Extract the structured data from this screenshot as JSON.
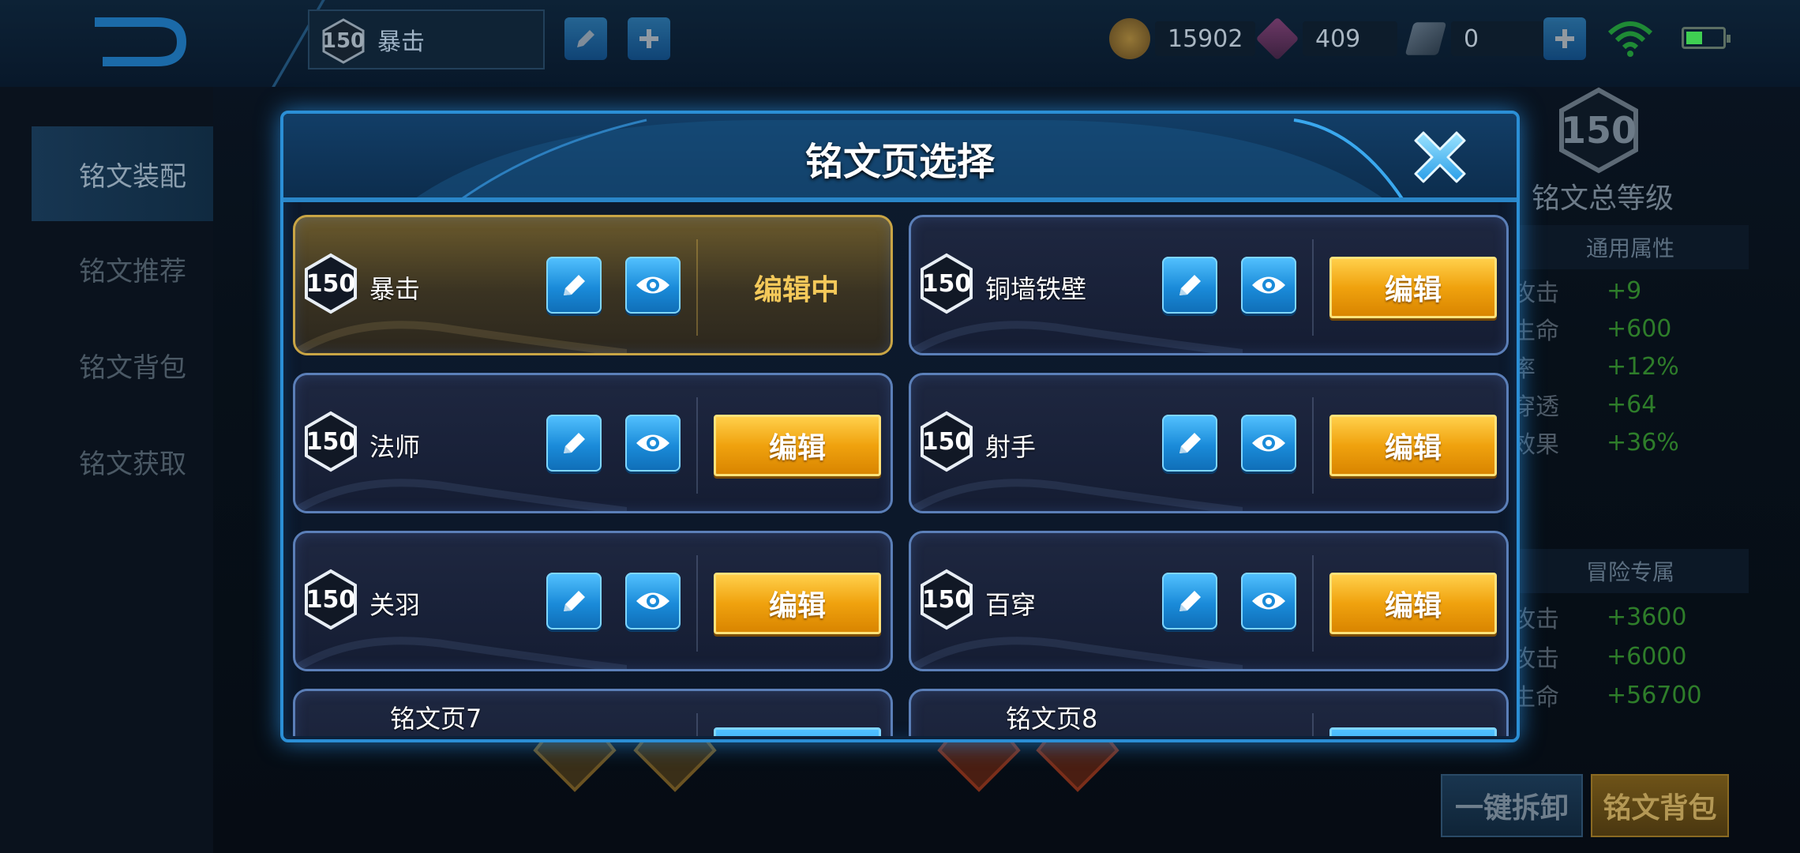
{
  "topbar": {
    "current_page_level": "150",
    "current_page_name": "暴击",
    "currencies": [
      {
        "icon": "gold-coin-icon",
        "value": "15902",
        "color": "#e0a030"
      },
      {
        "icon": "diamond-icon",
        "value": "409",
        "color": "#c05aa0"
      },
      {
        "icon": "voucher-icon",
        "value": "0",
        "color": "#7a8a9a"
      }
    ]
  },
  "sidebar": {
    "items": [
      {
        "label": "铭文装配",
        "active": true
      },
      {
        "label": "铭文推荐",
        "active": false
      },
      {
        "label": "铭文背包",
        "active": false
      },
      {
        "label": "铭文获取",
        "active": false
      }
    ]
  },
  "right_panel": {
    "total_level": "150",
    "total_level_label": "铭文总等级",
    "general_header": "通用属性",
    "general_stats": [
      {
        "name": "攻击",
        "value": "+9"
      },
      {
        "name": "生命",
        "value": "+600"
      },
      {
        "name": "率",
        "value": "+12%"
      },
      {
        "name": "穿透",
        "value": "+64"
      },
      {
        "name": "效果",
        "value": "+36%"
      }
    ],
    "adventure_header": "冒险专属",
    "adventure_stats": [
      {
        "name": "攻击",
        "value": "+3600"
      },
      {
        "name": "攻击",
        "value": "+6000"
      },
      {
        "name": "生命",
        "value": "+56700"
      }
    ],
    "unequip_label": "一键拆卸",
    "bag_label": "铭文背包"
  },
  "modal": {
    "title": "铭文页选择",
    "edit_label": "编辑",
    "editing_label": "编辑中",
    "pages": [
      {
        "level": "150",
        "name": "暴击",
        "active": true
      },
      {
        "level": "150",
        "name": "铜墙铁壁",
        "active": false
      },
      {
        "level": "150",
        "name": "法师",
        "active": false
      },
      {
        "level": "150",
        "name": "射手",
        "active": false
      },
      {
        "level": "150",
        "name": "关羽",
        "active": false
      },
      {
        "level": "150",
        "name": "百穿",
        "active": false
      },
      {
        "level": "",
        "name": "铭文页7",
        "active": false
      },
      {
        "level": "",
        "name": "铭文页8",
        "active": false
      }
    ]
  },
  "colors": {
    "modal_border": "#2b8fd6",
    "edit_button": "#f0a20e",
    "active_card_border": "#c9a545",
    "stat_value_green": "#2e7d2a"
  }
}
